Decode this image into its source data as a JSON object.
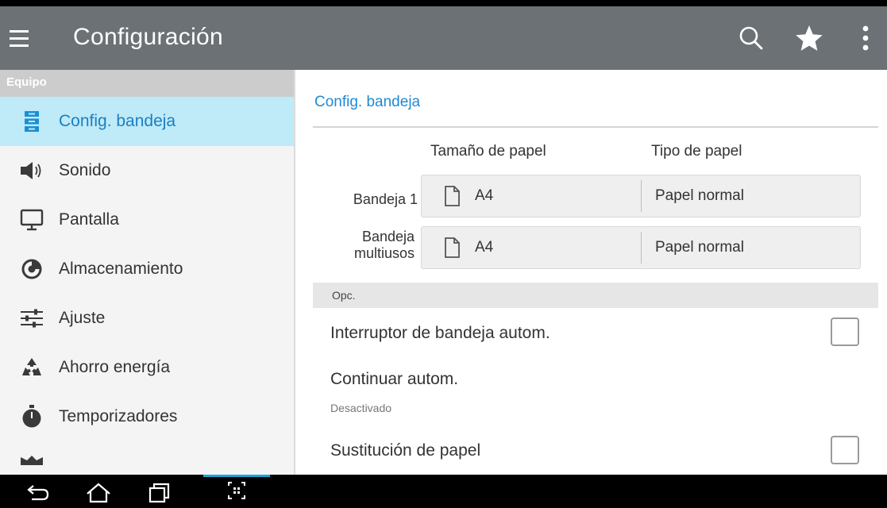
{
  "app_bar": {
    "title": "Configuración",
    "icons": [
      "menu-icon",
      "search-icon",
      "star-icon",
      "more-vert-icon"
    ]
  },
  "sidebar": {
    "header": "Equipo",
    "items": [
      {
        "label": "Config. bandeja",
        "icon": "tray-icon",
        "active": true
      },
      {
        "label": "Sonido",
        "icon": "speaker-icon"
      },
      {
        "label": "Pantalla",
        "icon": "monitor-icon"
      },
      {
        "label": "Almacenamiento",
        "icon": "storage-icon"
      },
      {
        "label": "Ajuste",
        "icon": "sliders-icon"
      },
      {
        "label": "Ahorro energía",
        "icon": "recycle-icon"
      },
      {
        "label": "Temporizadores",
        "icon": "stopwatch-icon"
      }
    ]
  },
  "content": {
    "title": "Config. bandeja",
    "columns": {
      "size": "Tamaño de papel",
      "type": "Tipo de papel"
    },
    "trays": [
      {
        "label_1": "Bandeja 1",
        "label_2": "",
        "size": "A4",
        "type": "Papel normal"
      },
      {
        "label_1": "Bandeja",
        "label_2": "multiusos",
        "size": "A4",
        "type": "Papel normal"
      }
    ],
    "options_header": "Opc.",
    "options": [
      {
        "label": "Interruptor de bandeja autom.",
        "checked": false
      },
      {
        "label": "Continuar autom.",
        "sub": "Desactivado"
      },
      {
        "label": "Sustitución de papel",
        "checked": false
      }
    ]
  },
  "nav_bar": {
    "icons": [
      "back-icon",
      "home-icon",
      "recent-apps-icon",
      "screen-capture-icon"
    ]
  },
  "colors": {
    "app_bar": "#6c7175",
    "accent": "#1e8ad6",
    "active_item_bg": "#bfeaf8",
    "nav_highlight": "#18a6d8"
  }
}
